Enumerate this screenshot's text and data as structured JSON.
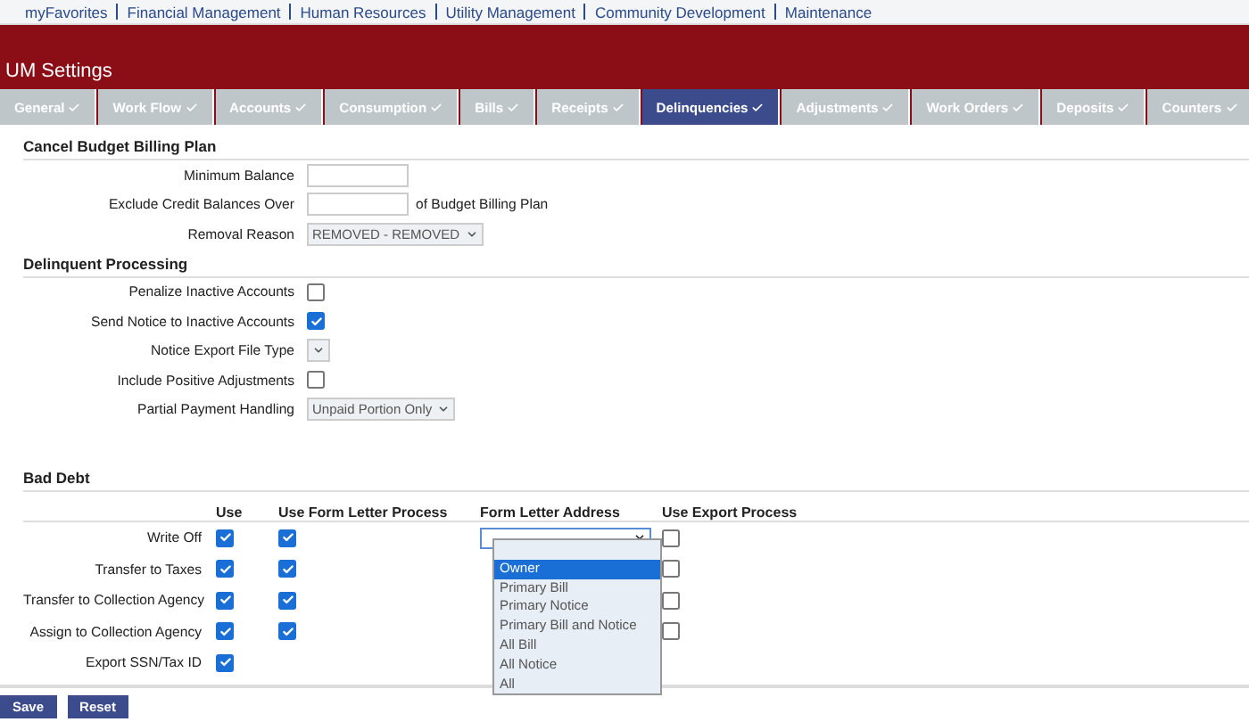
{
  "top_nav": [
    "myFavorites",
    "Financial Management",
    "Human Resources",
    "Utility Management",
    "Community Development",
    "Maintenance"
  ],
  "header": {
    "title": "UM Settings"
  },
  "tabs": [
    {
      "label": "General",
      "selected": false
    },
    {
      "label": "Work Flow",
      "selected": false
    },
    {
      "label": "Accounts",
      "selected": false
    },
    {
      "label": "Consumption",
      "selected": false
    },
    {
      "label": "Bills",
      "selected": false
    },
    {
      "label": "Receipts",
      "selected": false
    },
    {
      "label": "Delinquencies",
      "selected": true
    },
    {
      "label": "Adjustments",
      "selected": false
    },
    {
      "label": "Work Orders",
      "selected": false
    },
    {
      "label": "Deposits",
      "selected": false
    },
    {
      "label": "Counters",
      "selected": false
    }
  ],
  "sections": [
    {
      "title": "Cancel Budget Billing Plan",
      "fields": [
        {
          "kind": "text",
          "label": "Minimum Balance"
        },
        {
          "kind": "text",
          "label": "Exclude Credit Balances Over",
          "suffix": "of Budget Billing Plan"
        },
        {
          "kind": "select",
          "label": "Removal Reason",
          "value": "REMOVED - REMOVED"
        }
      ]
    },
    {
      "title": "Delinquent Processing",
      "fields": [
        {
          "kind": "checkbox",
          "label": "Penalize Inactive Accounts",
          "checked": false
        },
        {
          "kind": "checkbox",
          "label": "Send Notice to Inactive Accounts",
          "checked": true
        },
        {
          "kind": "select",
          "label": "Notice Export File Type"
        },
        {
          "kind": "checkbox",
          "label": "Include Positive Adjustments",
          "checked": false
        },
        {
          "kind": "select",
          "label": "Partial Payment Handling",
          "value": "Unpaid Portion Only"
        }
      ]
    }
  ],
  "bad_debt": {
    "title": "Bad Debt",
    "columns": [
      "Use",
      "Use Form Letter Process",
      "Form Letter Address",
      "Use Export Process"
    ],
    "rows": [
      {
        "label": "Write Off",
        "use": true,
        "form_letter": true,
        "export": false,
        "address_select": true
      },
      {
        "label": "Transfer to Taxes",
        "use": true,
        "form_letter": true,
        "export": false
      },
      {
        "label": "Transfer to Collection Agency",
        "use": true,
        "form_letter": true,
        "export": false
      },
      {
        "label": "Assign to Collection Agency",
        "use": true,
        "form_letter": true,
        "export": false
      },
      {
        "label": "Export SSN/Tax ID",
        "use": true
      }
    ],
    "address_options": [
      {
        "label": "Owner",
        "selected": true
      },
      {
        "label": "Primary Bill",
        "selected": false
      },
      {
        "label": "Primary Notice",
        "selected": false
      },
      {
        "label": "Primary Bill and Notice",
        "selected": false
      },
      {
        "label": "All Bill",
        "selected": false
      },
      {
        "label": "All Notice",
        "selected": false
      },
      {
        "label": "All",
        "selected": false
      }
    ]
  },
  "buttons": [
    "Save",
    "Reset"
  ]
}
